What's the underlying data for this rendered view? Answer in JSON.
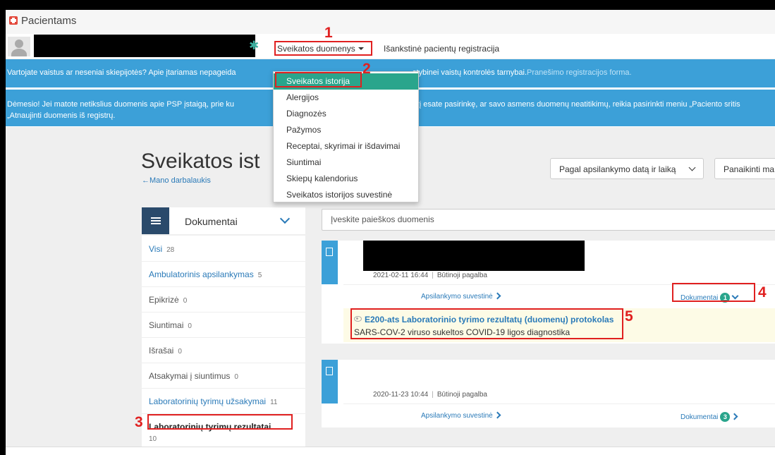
{
  "app": {
    "title": "Pacientams"
  },
  "topnav": {
    "health_data_label": "Sveikatos duomenys",
    "registration_label": "Išankstinė pacientų registracija"
  },
  "dropdown": {
    "items": [
      {
        "label": "Sveikatos istorija"
      },
      {
        "label": "Alergijos"
      },
      {
        "label": "Diagnozės"
      },
      {
        "label": "Pažymos"
      },
      {
        "label": "Receptai, skyrimai ir išdavimai"
      },
      {
        "label": "Siuntimai"
      },
      {
        "label": "Skiepų kalendorius"
      },
      {
        "label": "Sveikatos istorijos suvestinė"
      }
    ]
  },
  "alerts": {
    "first_left": "Vartojate vaistus ar neseniai skiepijotės? Apie įtariamas nepageida",
    "first_right": "stybinei vaistų kontrolės tarnybai.",
    "first_link": "Pranešimo registracijos forma.",
    "second_left": "Dėmesio! Jei matote netikslius duomenis apie PSP įstaigą, prie ku",
    "second_right": "urį esate pasirinkę, ar savo asmens duomenų neatitikimų, reikia pasirinkti meniu „Paciento sritis",
    "second_line2": "„Atnaujinti duomenis iš registrų."
  },
  "page": {
    "title": "Sveikatos ist",
    "back_link": "←Mano darbalaukis",
    "sort_label": "Pagal apsilankymo datą ir laiką",
    "clear_label": "Panaikinti ma",
    "search_placeholder": "Įveskite paieškos duomenis"
  },
  "sidebar": {
    "header": "Dokumentai",
    "items": [
      {
        "label": "Visi",
        "count": "28"
      },
      {
        "label": "Ambulatorinis apsilankymas",
        "count": "5"
      },
      {
        "label": "Epikrizė",
        "count": "0"
      },
      {
        "label": "Siuntimai",
        "count": "0"
      },
      {
        "label": "Išrašai",
        "count": "0"
      },
      {
        "label": "Atsakymai į siuntimus",
        "count": "0"
      },
      {
        "label": "Laboratorinių tyrimų užsakymai",
        "count": "11"
      },
      {
        "label": "Laboratorinių tyrimų rezultatai",
        "count": "10"
      }
    ]
  },
  "visits": [
    {
      "date": "2021-02-11 16:44",
      "type": "Būtinoji pagalba",
      "summary_link": "Apsilankymo suvestinė",
      "docs_link": "Dokumentai",
      "docs_count": "1",
      "document": {
        "title": "E200-ats Laboratorinio tyrimo rezultatų (duomenų) protokolas",
        "subtitle": "SARS-COV-2 viruso sukeltos COVID-19 ligos diagnostika"
      }
    },
    {
      "date": "2020-11-23 10:44",
      "type": "Būtinoji pagalba",
      "summary_link": "Apsilankymo suvestinė",
      "docs_link": "Dokumentai",
      "docs_count": "3"
    }
  ],
  "annotations": [
    "1",
    "2",
    "3",
    "4",
    "5"
  ],
  "colors": {
    "accent": "#3ca0d8",
    "active": "#2aa58c",
    "link": "#2a7ab8",
    "annotation": "#e02020",
    "sidebar_header": "#2a4a6b"
  }
}
